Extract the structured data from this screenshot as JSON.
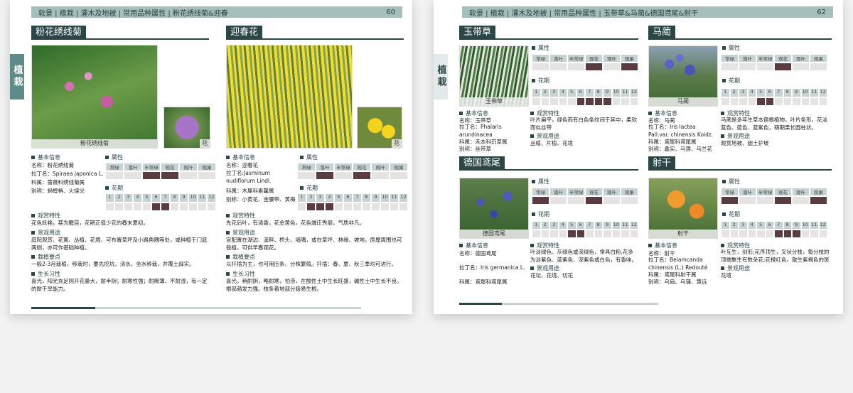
{
  "page_left": {
    "breadcrumb": "软景 | 植栽 | 灌木及地被 | 常用品种属性 | 粉花绣线菊&迎春",
    "page_no": "60",
    "side_tab": "植栽",
    "plant1": {
      "title": "粉花绣线菊",
      "photo_caption": "粉花绣线菊",
      "photo2_caption": "花",
      "basic_header": "基本信息",
      "name": "名称：粉花绣线菊",
      "latin": "拉丁名：Spiraea japonica L. f.",
      "family": "科属：蔷薇科绣线菊属",
      "alias": "别称：蚂蝗梢、火烧尖",
      "attr_header": "属性",
      "attr_labels": [
        "常绿",
        "落叶",
        "半常绿",
        "观花",
        "观叶",
        "观果"
      ],
      "flower_header": "花期",
      "months": [
        "1",
        "2",
        "3",
        "4",
        "5",
        "6",
        "7",
        "8",
        "9",
        "10",
        "11",
        "12"
      ],
      "ornamental_header": "观赏特性",
      "ornamental": "花色妖艳，甚为醒目，花期正值少花的春末夏初。",
      "landscape_header": "景观用途",
      "landscape": "庭院观赏、花篱、丛植、花境、可布置草坪及小路角隅等处，或种植于门庭两侧，亦可作基础种植。",
      "cultivation_header": "栽植要点",
      "cultivation": "一般2-3月栽植，移栽时，要先挖坑，浇水，坐水移栽，并覆土踩实。",
      "habit_header": "生长习性",
      "habit": "喜光，阳光充足则开花量大，耐半阴；耐寒性强；耐瘠薄、不耐湿，有一定的耐干旱能力。"
    },
    "plant2": {
      "title": "迎春花",
      "photo2_caption": "花",
      "basic_header": "基本信息",
      "name": "名称：迎春花",
      "latin": "拉丁名:Jasminum nudiflorum Lindl.",
      "family": "科属：木犀科素馨属",
      "alias": "别称：小黄花、金腰带、黄梅",
      "attr_header": "属性",
      "attr_labels": [
        "常绿",
        "落叶",
        "半常绿",
        "观花",
        "观叶",
        "观果"
      ],
      "flower_header": "花期",
      "months": [
        "1",
        "2",
        "3",
        "4",
        "5",
        "6",
        "7",
        "8",
        "9",
        "10",
        "11",
        "12"
      ],
      "ornamental_header": "观赏特性",
      "ornamental": "先花后叶，有清香，花金黄色，花色端庄秀丽，气质非凡。",
      "landscape_header": "景观用途",
      "landscape": "宜配置在湖边、溪畔、桥头、墙隅，或在草坪、林缘、坡地，房屋周围也可栽植，可供早春观花。",
      "cultivation_header": "栽植要点",
      "cultivation": "以扦插为主，也可用压条、分株繁殖。扦插：春、夏、秋三季均可进行。",
      "habit_header": "生长习性",
      "habit": "喜光，稍耐阴，略耐寒，怕涝，在酸性土中生长旺盛，碱性土中生长不良。根部萌发力强。枝条着地部分极易生根。"
    }
  },
  "page_right": {
    "breadcrumb": "软景 | 植栽 | 灌木及地被 | 常用品种属性 | 玉带草&马蔺&德国鸢尾&射干",
    "page_no": "62",
    "side_tab": "植栽",
    "plant1": {
      "title": "玉带草",
      "photo_caption": "玉带草",
      "attr_header": "属性",
      "attr_labels": [
        "常绿",
        "落叶",
        "半常绿",
        "观花",
        "观叶",
        "观果"
      ],
      "flower_header": "花期",
      "months": [
        "1",
        "2",
        "3",
        "4",
        "5",
        "6",
        "7",
        "8",
        "9",
        "10",
        "11",
        "12"
      ],
      "basic_header": "基本信息",
      "name": "名称：玉带草",
      "latin": "拉丁名：Phalaris arundinacea",
      "family": "科属：禾本科䒛草属",
      "alias": "别称：丝带草",
      "ornamental_header": "观赏特性",
      "ornamental": "叶片扁平，绿色而有白色条纹间于其中，柔软而似丝带",
      "landscape_header": "景观用途",
      "landscape": "丛植、片植、花境"
    },
    "plant2": {
      "title": "马蔺",
      "photo_caption": "马蔺",
      "attr_header": "属性",
      "attr_labels": [
        "常绿",
        "落叶",
        "半常绿",
        "观花",
        "观叶",
        "观果"
      ],
      "flower_header": "花期",
      "months": [
        "1",
        "2",
        "3",
        "4",
        "5",
        "6",
        "7",
        "8",
        "9",
        "10",
        "11",
        "12"
      ],
      "basic_header": "基本信息",
      "name": "名称：马蔺",
      "latin": "拉丁名：Iris lactea Pall.var. chinensis Koidz.",
      "family": "科属：鸢尾科鸢尾属",
      "alias": "别称：蠡实、马莲、马兰花",
      "ornamental_header": "观赏特性",
      "ornamental": "马蔺是多年生草本宿根植物，叶片条形，花淡蓝色、蓝色、蓝紫色，萌期果长圆柱状。",
      "landscape_header": "景观用途",
      "landscape": "观赏地被、固土护坡"
    },
    "plant3": {
      "title": "德国鸢尾",
      "photo_caption": "德国鸢尾",
      "attr_header": "属性",
      "attr_labels": [
        "常绿",
        "落叶",
        "半常绿",
        "观花",
        "观叶",
        "观果"
      ],
      "flower_header": "花期",
      "months": [
        "1",
        "2",
        "3",
        "4",
        "5",
        "6",
        "7",
        "8",
        "9",
        "10",
        "11",
        "12"
      ],
      "basic_header": "基本信息",
      "name": "名称：德国鸢尾",
      "latin": "拉丁名：Iris germanica L.",
      "family": "科属：鸢尾科鸢尾属",
      "ornamental_header": "观赏特性",
      "ornamental": "叶淡绿色、灰绿色或深绿色，常具白粉,花多为淡紫色、蓝紫色、深紫色或白色，有香味。",
      "landscape_header": "景观用途",
      "landscape": "花坛、花境、切花"
    },
    "plant4": {
      "title": "射干",
      "photo_caption": "射干",
      "attr_header": "属性",
      "attr_labels": [
        "常绿",
        "落叶",
        "半常绿",
        "观花",
        "观叶",
        "观果"
      ],
      "flower_header": "花期",
      "months": [
        "1",
        "2",
        "3",
        "4",
        "5",
        "6",
        "7",
        "8",
        "9",
        "10",
        "11",
        "12"
      ],
      "basic_header": "基本信息",
      "name": "名称：射干",
      "latin": "拉丁名：Belamcanda chinensis (L.) Redouté",
      "family": "科属：鸢尾科射干属",
      "alias": "别称：乌扇、乌蒲、黄远",
      "ornamental_header": "观赏特性",
      "ornamental": "叶互生，剑形;花序顶生，叉状分枝，每分枝的顶端聚生有数朵花;花橙红色，散生紫褐色的斑点。",
      "landscape_header": "景观用途",
      "landscape": "花境"
    }
  },
  "colors": {
    "header_bg": "#a6bfbd",
    "title_bg": "#2c4545",
    "cell_on": "#5a3b3f",
    "cell_off": "#e6e3e3"
  }
}
